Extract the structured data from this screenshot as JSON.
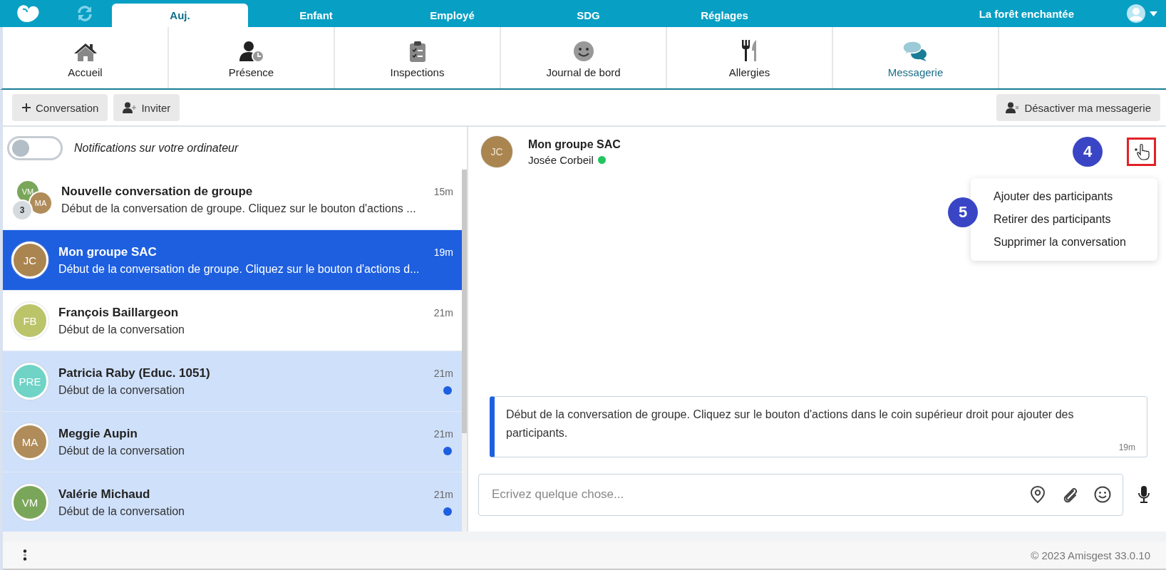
{
  "top_nav": {
    "tabs": [
      {
        "label": "Auj.",
        "selected": true
      },
      {
        "label": "Enfant",
        "selected": false
      },
      {
        "label": "Employé",
        "selected": false
      },
      {
        "label": "SDG",
        "selected": false
      },
      {
        "label": "Réglages",
        "selected": false
      }
    ],
    "site_name": "La forêt enchantée"
  },
  "modules": [
    {
      "label": "Accueil",
      "kind": "house",
      "selected": false
    },
    {
      "label": "Présence",
      "kind": "attendance",
      "selected": false
    },
    {
      "label": "Inspections",
      "kind": "clipboard",
      "selected": false
    },
    {
      "label": "Journal de bord",
      "kind": "smiley",
      "selected": false
    },
    {
      "label": "Allergies",
      "kind": "cutlery",
      "selected": false
    },
    {
      "label": "Messagerie",
      "kind": "chat",
      "selected": true
    }
  ],
  "toolbar": {
    "buttons": [
      {
        "label": "Conversation",
        "kind": "plus"
      },
      {
        "label": "Inviter",
        "kind": "user-plus"
      }
    ],
    "right_button": {
      "label": "Désactiver ma messagerie",
      "kind": "user-x"
    }
  },
  "notifications": {
    "label": "Notifications sur votre ordinateur",
    "on": false
  },
  "conversations": [
    {
      "kind": "group",
      "title": "Nouvelle conversation de groupe",
      "preview": "Début de la conversation de groupe. Cliquez sur le bouton d'actions ...",
      "time": "15m",
      "selected": false,
      "unread": false,
      "avatars": [
        {
          "initials": "VM",
          "color": "#7aa65a"
        },
        {
          "initials": "MA",
          "color": "#b08c5a"
        }
      ],
      "count": "3"
    },
    {
      "kind": "single",
      "title": "Mon groupe SAC",
      "preview": "Début de la conversation de groupe. Cliquez sur le bouton d'actions d...",
      "time": "19m",
      "selected": true,
      "unread": false,
      "initials": "JC",
      "color": "#aa8550"
    },
    {
      "kind": "single",
      "title": "François Baillargeon",
      "preview": "Début de la conversation",
      "time": "21m",
      "selected": false,
      "unread": false,
      "initials": "FB",
      "color": "#bcc46a"
    },
    {
      "kind": "single",
      "title": "Patricia Raby (Educ. 1051)",
      "preview": "Début de la conversation",
      "time": "21m",
      "selected": false,
      "unread": true,
      "initials": "PRE",
      "color": "#6fd3c6"
    },
    {
      "kind": "single",
      "title": "Meggie Aupin",
      "preview": "Début de la conversation",
      "time": "21m",
      "selected": false,
      "unread": true,
      "initials": "MA",
      "color": "#b08c5a"
    },
    {
      "kind": "single",
      "title": "Valérie Michaud",
      "preview": "Début de la conversation",
      "time": "21m",
      "selected": false,
      "unread": true,
      "initials": "VM",
      "color": "#7aa65a"
    }
  ],
  "chat": {
    "title": "Mon groupe SAC",
    "avatar": {
      "initials": "JC",
      "color": "#aa8550"
    },
    "member": "Josée Corbeil",
    "online": true,
    "menu": [
      "Ajouter des participants",
      "Retirer des participants",
      "Supprimer la conversation"
    ],
    "messages": [
      {
        "text": "Début de la conversation de groupe. Cliquez sur le bouton d'actions dans le coin supérieur droit pour ajouter des participants.",
        "time": "19m"
      }
    ],
    "composer": {
      "placeholder": "Ecrivez quelque chose..."
    }
  },
  "annotations": [
    "4",
    "5"
  ],
  "footer": {
    "copyright": "© 2023 Amisgest 33.0.10"
  }
}
